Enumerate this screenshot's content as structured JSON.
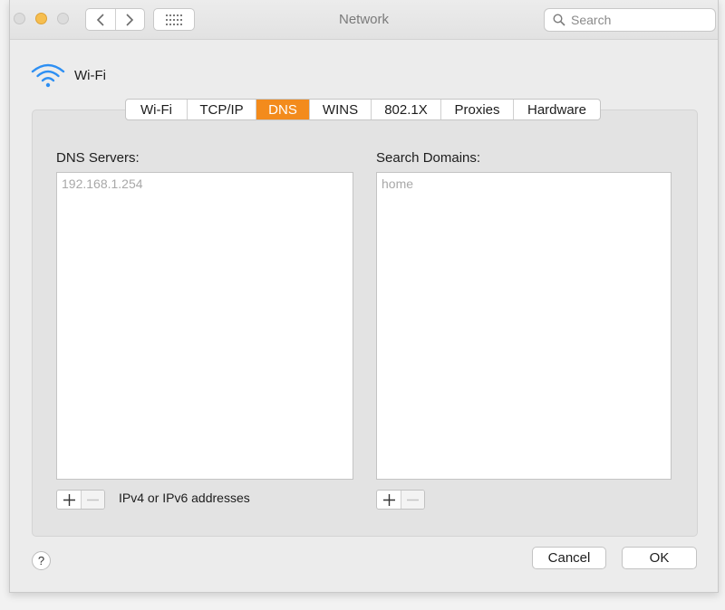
{
  "window": {
    "title": "Network",
    "search_placeholder": "Search"
  },
  "interface": {
    "name": "Wi-Fi",
    "icon": "wifi-icon"
  },
  "tabs": [
    {
      "label": "Wi-Fi",
      "active": false
    },
    {
      "label": "TCP/IP",
      "active": false
    },
    {
      "label": "DNS",
      "active": true
    },
    {
      "label": "WINS",
      "active": false
    },
    {
      "label": "802.1X",
      "active": false
    },
    {
      "label": "Proxies",
      "active": false
    },
    {
      "label": "Hardware",
      "active": false
    }
  ],
  "dns": {
    "servers_label": "DNS Servers:",
    "servers": [
      "192.168.1.254"
    ],
    "hint": "IPv4 or IPv6 addresses",
    "domains_label": "Search Domains:",
    "domains": [
      "home"
    ]
  },
  "footer": {
    "help": "?",
    "cancel": "Cancel",
    "ok": "OK"
  },
  "colors": {
    "accent": "#f38b1c",
    "traffic_minimize": "#f6be4f"
  }
}
